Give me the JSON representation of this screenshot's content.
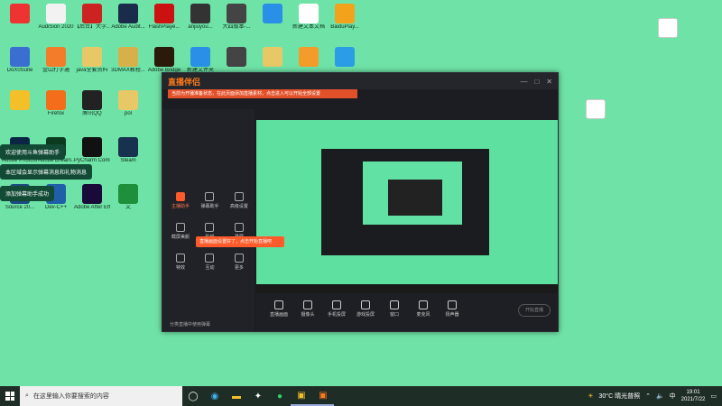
{
  "desktop": {
    "icons": [
      {
        "label": "",
        "color": "#e33"
      },
      {
        "label": "AudiSion 2020",
        "color": "#f2f2f2"
      },
      {
        "label": "【后台】大学...",
        "color": "#c22"
      },
      {
        "label": "Adobe Audit...",
        "color": "#1b2b4a"
      },
      {
        "label": "FlashPlaye...",
        "color": "#c11"
      },
      {
        "label": "anjiuyou...",
        "color": "#333"
      },
      {
        "label": "大四版本-...",
        "color": "#444"
      },
      {
        "label": "",
        "color": "#2a8fe6"
      },
      {
        "label": "新建文本文档",
        "color": "#fff"
      },
      {
        "label": "BaiduPlay...",
        "color": "#f3a31b"
      },
      {
        "label": "DoX0Suite",
        "color": "#3a6fd1"
      },
      {
        "label": "金山打字通",
        "color": "#f37c2a"
      },
      {
        "label": "java全套资料",
        "color": "#e8c766"
      },
      {
        "label": "3DMAX教程...",
        "color": "#d8b04a"
      },
      {
        "label": "Adobe Bridge",
        "color": "#2b1a0a"
      },
      {
        "label": "新建文件夹",
        "color": "#2a8fe6"
      },
      {
        "label": "",
        "color": "#444"
      },
      {
        "label": "",
        "color": "#e8c766"
      },
      {
        "label": "",
        "color": "#f39c2a"
      },
      {
        "label": "",
        "color": "#2a9de6"
      },
      {
        "label": "",
        "color": "#f3c02a"
      },
      {
        "label": "Firefox",
        "color": "#f36d1b"
      },
      {
        "label": "腾讯QQ",
        "color": "#222"
      },
      {
        "label": "pol",
        "color": "#e8c766"
      },
      {
        "label": "Adobe Photosh...",
        "color": "#0b2545"
      },
      {
        "label": "Adobe Dream...",
        "color": "#0a3b1f"
      },
      {
        "label": "PyCharm Command...",
        "color": "#111"
      },
      {
        "label": "Steam",
        "color": "#16324f"
      },
      {
        "label": "Source 20... ",
        "color": "#1b4a80"
      },
      {
        "label": "Dev-C++",
        "color": "#1e5fa8"
      },
      {
        "label": "Adobe After Effects 2020",
        "color": "#1a0a3a"
      },
      {
        "label": "文",
        "color": "#1e8f3a"
      }
    ]
  },
  "bubbles": [
    "欢迎使用斗鱼弹幕助手",
    "本区域会显示弹幕消息和礼物消息",
    "添加弹幕助手成功"
  ],
  "app": {
    "logo": "直播伴侣",
    "notice": "当前为开播准备状态，在此页面添加直播素材，点击进入可以开始全部设置",
    "sidebar": [
      "主播助手",
      "弹幕助手",
      "高级设置",
      "截屏美颜",
      "贴纸",
      "录屏",
      "特效",
      "互动",
      "更多"
    ],
    "toolbar": [
      "直播画面",
      "摄像头",
      "手机投屏",
      "游戏投屏",
      "窗口",
      "麦克风",
      "扬声器"
    ],
    "start_label": "开始直播",
    "popup": "直播画面设置好了，点击开始直播吧",
    "footer": "分类直播中使用弹幕"
  },
  "taskbar": {
    "search_placeholder": "在这里输入你要搜索的内容",
    "apps": [
      "task-view-icon",
      "edge-icon",
      "explorer-icon",
      "settings-icon",
      "app-icon",
      "qq-icon",
      "live-companion-icon"
    ],
    "weather": "30°C 晴光普照",
    "time": "19:01",
    "date": "2021/7/22",
    "lang": "中"
  }
}
